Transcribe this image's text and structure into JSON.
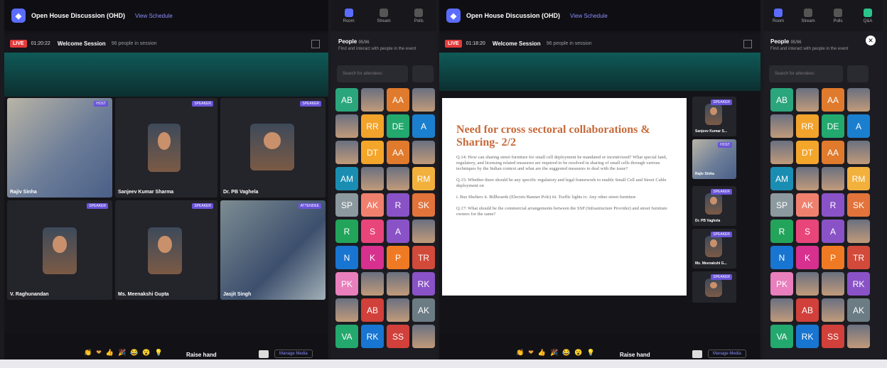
{
  "app": {
    "title": "Open House Discussion (OHD)",
    "link": "View Schedule"
  },
  "session": {
    "live": "LIVE",
    "timer_left": "01:20:22",
    "timer_right": "01:18:20",
    "title": "Welcome Session",
    "sub": "96 people in session"
  },
  "tiles_left": [
    {
      "name": "Rajiv Sinha",
      "tag": "HOST"
    },
    {
      "name": "Sanjeev Kumar Sharma",
      "tag": "SPEAKER"
    },
    {
      "name": "Dr. PB Vaghela",
      "tag": "SPEAKER"
    },
    {
      "name": "V. Raghunandan",
      "tag": "SPEAKER"
    },
    {
      "name": "Ms. Meenakshi Gupta",
      "tag": "SPEAKER"
    },
    {
      "name": "Jasjit Singh",
      "tag": "ATTENDEE"
    }
  ],
  "side_tiles_right": [
    {
      "name": "Sanjeev Kumar S...",
      "tag": "SPEAKER"
    },
    {
      "name": "Rajiv Sinha",
      "tag": "HOST"
    },
    {
      "name": "Dr. PB Vaghela",
      "tag": "SPEAKER"
    },
    {
      "name": "Ms. Meenakshi G...",
      "tag": "SPEAKER"
    },
    {
      "name": "",
      "tag": "SPEAKER"
    }
  ],
  "slide": {
    "title": "Need for cross sectoral collaborations & Sharing- 2/2",
    "paragraphs": [
      "Q.14: How can sharing street furniture for small cell deployment be mandated or incentivized? What special land, regulatory, and licensing related measures are required to be resolved in sharing of small cells through various techniques by the Indian context and what are the suggested measures to deal with the issue?",
      "Q.15: Whether there should be any specific regulatory and legal framework to enable Small Cell and Street Cable deployment on",
      "i. Bus Shelters ii. Billboards (Electric/Banner Pole) iii. Traffic lights iv. Any other street furniture",
      "Q.17: What should be the commercial arrangements between the SSP (Infrastructure Provider) and street furniture owners for the same?"
    ]
  },
  "people": {
    "tabs": [
      "Room",
      "Stream",
      "Polls",
      "Q&A"
    ],
    "title": "People",
    "count": "95/96",
    "subtitle": "Find and interact with people in the event",
    "search_placeholder": "Search for attendees",
    "avatars": [
      {
        "t": "AB",
        "c": "#2aa57c"
      },
      {
        "t": "",
        "c": "img"
      },
      {
        "t": "AA",
        "c": "#e07a2c"
      },
      {
        "t": "",
        "c": "img"
      },
      {
        "t": "",
        "c": "img"
      },
      {
        "t": "RR",
        "c": "#f2a32b"
      },
      {
        "t": "DE",
        "c": "#23a86e"
      },
      {
        "t": "A",
        "c": "#1b7fcf"
      },
      {
        "t": "",
        "c": "img"
      },
      {
        "t": "DT",
        "c": "#f4a62b"
      },
      {
        "t": "AA",
        "c": "#e07a2c"
      },
      {
        "t": "",
        "c": "img"
      },
      {
        "t": "AM",
        "c": "#1a8db3"
      },
      {
        "t": "",
        "c": "img"
      },
      {
        "t": "",
        "c": "img"
      },
      {
        "t": "RM",
        "c": "#f2b03c"
      },
      {
        "t": "SP",
        "c": "#8c9aa0"
      },
      {
        "t": "AK",
        "c": "#f0806e"
      },
      {
        "t": "R",
        "c": "#8a52c7"
      },
      {
        "t": "SK",
        "c": "#e2733a"
      },
      {
        "t": "R",
        "c": "#23a45b"
      },
      {
        "t": "S",
        "c": "#e8457a"
      },
      {
        "t": "A",
        "c": "#8a52c7"
      },
      {
        "t": "",
        "c": "img"
      },
      {
        "t": "N",
        "c": "#1875d1"
      },
      {
        "t": "K",
        "c": "#d7308e"
      },
      {
        "t": "P",
        "c": "#f07a23"
      },
      {
        "t": "TR",
        "c": "#d24a3a"
      },
      {
        "t": "PK",
        "c": "#e97fbc"
      },
      {
        "t": "",
        "c": "img"
      },
      {
        "t": "",
        "c": "img"
      },
      {
        "t": "RK",
        "c": "#8a52c7"
      },
      {
        "t": "",
        "c": "img"
      },
      {
        "t": "AB",
        "c": "#d1403a"
      },
      {
        "t": "",
        "c": "img"
      },
      {
        "t": "AK",
        "c": "#6c7c84"
      },
      {
        "t": "VA",
        "c": "#23a86e"
      },
      {
        "t": "RK",
        "c": "#1875d1"
      },
      {
        "t": "SS",
        "c": "#d1403a"
      },
      {
        "t": "",
        "c": "img"
      }
    ]
  },
  "controls": {
    "raise": "Raise hand",
    "more": "Manage Media",
    "reactions": [
      "👏",
      "❤",
      "👍",
      "🎉",
      "😂",
      "😮",
      "💡"
    ]
  },
  "colors": {
    "accent": "#5b6cff",
    "live": "#e23b3b"
  }
}
